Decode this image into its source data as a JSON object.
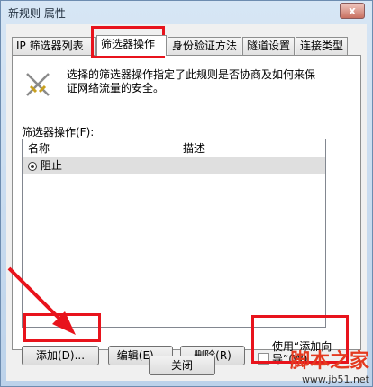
{
  "window": {
    "title": "新规则 属性",
    "close_label": "x"
  },
  "tabs": [
    {
      "label": "IP 筛选器列表",
      "active": false
    },
    {
      "label": "筛选器操作",
      "active": true
    },
    {
      "label": "身份验证方法",
      "active": false
    },
    {
      "label": "隧道设置",
      "active": false
    },
    {
      "label": "连接类型",
      "active": false
    }
  ],
  "panel": {
    "description": "选择的筛选器操作指定了此规则是否协商及如何来保证网络流量的安全。",
    "list_label": "筛选器操作(F):",
    "columns": [
      "名称",
      "描述"
    ],
    "rows": [
      {
        "name": "阻止",
        "description": "",
        "selected": true
      }
    ]
  },
  "buttons": {
    "add": "添加(D)...",
    "edit": "编辑(E)...",
    "remove": "删除(R)",
    "wizard_checkbox": "使用“添加向导”(W)",
    "wizard_checked": false
  },
  "footer": {
    "close": "关闭"
  },
  "watermark": {
    "logo": "脚本之家",
    "url": "www.jb51.net"
  },
  "colors": {
    "annotation_red": "#e8131c",
    "accent": "#6d8cb0"
  }
}
